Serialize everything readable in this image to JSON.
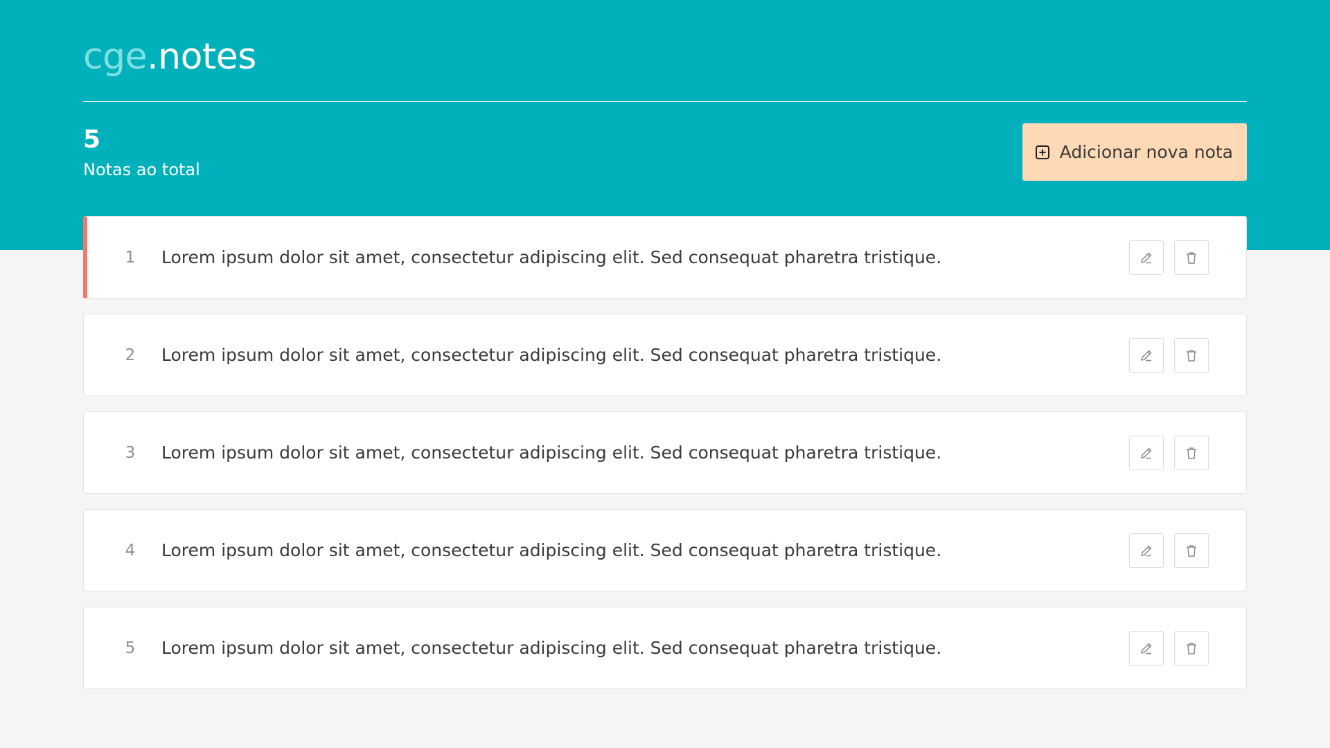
{
  "header": {
    "logo_brand": "cge",
    "logo_app": ".notes"
  },
  "summary": {
    "count": "5",
    "count_label": "Notas ao total"
  },
  "actions": {
    "add_label": "Adicionar nova nota"
  },
  "notes": [
    {
      "number": "1",
      "text": "Lorem ipsum dolor sit amet, consectetur adipiscing elit. Sed consequat pharetra tristique."
    },
    {
      "number": "2",
      "text": "Lorem ipsum dolor sit amet, consectetur adipiscing elit. Sed consequat pharetra tristique."
    },
    {
      "number": "3",
      "text": "Lorem ipsum dolor sit amet, consectetur adipiscing elit. Sed consequat pharetra tristique."
    },
    {
      "number": "4",
      "text": "Lorem ipsum dolor sit amet, consectetur adipiscing elit. Sed consequat pharetra tristique."
    },
    {
      "number": "5",
      "text": "Lorem ipsum dolor sit amet, consectetur adipiscing elit. Sed consequat pharetra tristique."
    }
  ],
  "icons": {
    "add": "plus-square-icon",
    "edit": "pencil-icon",
    "delete": "trash-icon"
  },
  "colors": {
    "header_bg": "#00b0bb",
    "add_button_bg": "#fdd9b6",
    "active_accent": "#f2786a",
    "page_bg": "#f5f5f5"
  }
}
